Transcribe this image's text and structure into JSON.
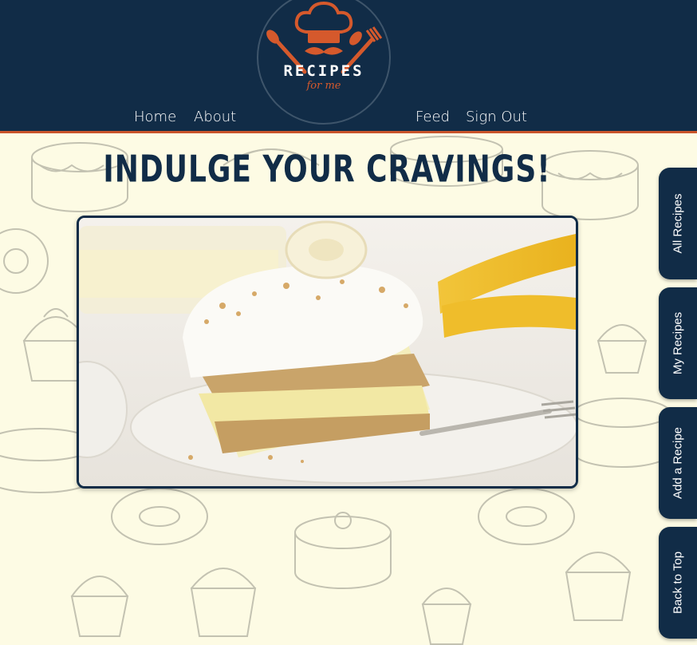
{
  "logo": {
    "title": "RECIPES",
    "subtitle": "for me"
  },
  "nav": {
    "home": "Home",
    "about": "About",
    "feed": "Feed",
    "sign_out": "Sign Out"
  },
  "hero": {
    "title": "INDULGE YOUR CRAVINGS!",
    "image_icon": "banana-pudding-cake-image"
  },
  "side_tabs": [
    "All Recipes",
    "My Recipes",
    "Add a Recipe",
    "Back to Top"
  ],
  "colors": {
    "header_bg": "#112c47",
    "accent": "#c9542a",
    "page_bg": "#fdfbe4"
  }
}
